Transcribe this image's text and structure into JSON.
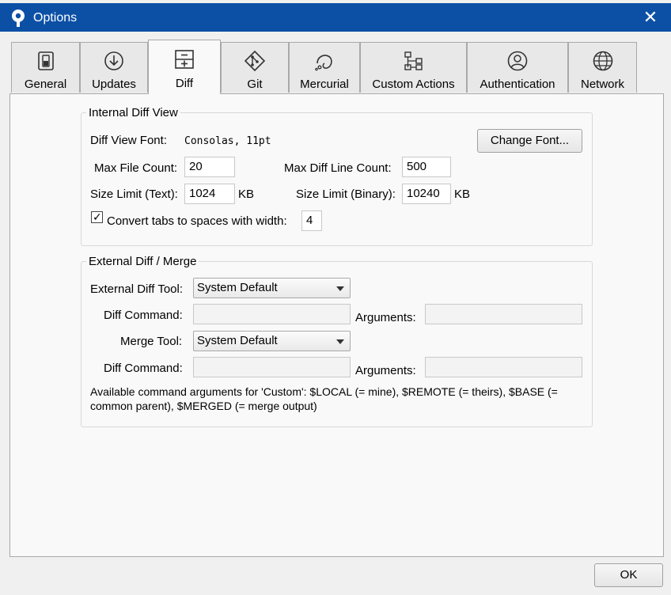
{
  "window": {
    "title": "Options"
  },
  "tabs": [
    {
      "label": "General"
    },
    {
      "label": "Updates"
    },
    {
      "label": "Diff"
    },
    {
      "label": "Git"
    },
    {
      "label": "Mercurial"
    },
    {
      "label": "Custom Actions"
    },
    {
      "label": "Authentication"
    },
    {
      "label": "Network"
    }
  ],
  "selected_tab": "Diff",
  "internal": {
    "legend": "Internal Diff View",
    "font_label": "Diff View Font:",
    "font_value": "Consolas, 11pt",
    "change_font_button": "Change Font...",
    "max_file_label": "Max File Count:",
    "max_file_value": "20",
    "max_line_label": "Max Diff Line Count:",
    "max_line_value": "500",
    "size_text_label": "Size Limit (Text):",
    "size_text_value": "1024",
    "size_text_unit": "KB",
    "size_bin_label": "Size Limit (Binary):",
    "size_bin_value": "10240",
    "size_bin_unit": "KB",
    "tabs_label": "Convert tabs to spaces with width:",
    "tabs_checked": true,
    "tabs_value": "4"
  },
  "external": {
    "legend": "External Diff / Merge",
    "diff_tool_label": "External Diff Tool:",
    "diff_tool_value": "System Default",
    "diff_command_label": "Diff Command:",
    "diff_command_value": "",
    "arguments_label": "Arguments:",
    "diff_arguments_value": "",
    "merge_tool_label": "Merge Tool:",
    "merge_tool_value": "System Default",
    "merge_command_label": "Diff Command:",
    "merge_command_value": "",
    "merge_arguments_label": "Arguments:",
    "merge_arguments_value": "",
    "note": "Available command arguments for 'Custom': $LOCAL (= mine), $REMOTE (= theirs), $BASE (= common parent), $MERGED (= merge output)"
  },
  "ok_button": "OK"
}
